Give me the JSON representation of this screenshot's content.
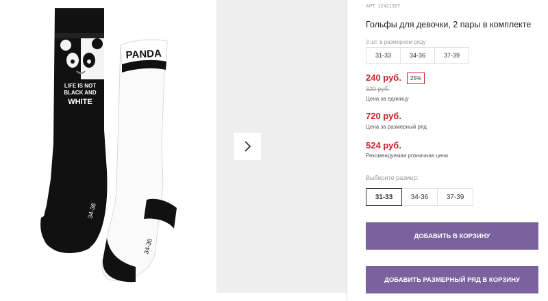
{
  "gallery": {
    "sock_left_print": [
      "LIFE IS NOT",
      "BLACK AND",
      "WHITE"
    ],
    "sock_right_print": "PANDA",
    "sock_size_mark": "34-36"
  },
  "product": {
    "article": "АРТ. 12421387",
    "title": "Гольфы для девочки, 2 пары в комплекте",
    "sizes_hint": "3 шт. в размерном ряду",
    "row_sizes": [
      "31-33",
      "34-36",
      "37-39"
    ],
    "price": "240 руб.",
    "discount": "25%",
    "old_price": "320 руб.",
    "price_unit_note": "Цена за единицу",
    "row_price": "720 руб.",
    "row_price_note": "Цена за размерный ряд",
    "rrp": "524 руб.",
    "rrp_note": "Рекомендуемая розничная цена",
    "choose_size_label": "Выберите размер:",
    "size_options": [
      "31-33",
      "34-36",
      "37-39"
    ],
    "selected_size": "31-33",
    "add_to_cart": "ДОБАВИТЬ В КОРЗИНУ",
    "add_row_to_cart": "ДОБАВИТЬ РАЗМЕРНЫЙ РЯД В КОРЗИНУ"
  },
  "colors": {
    "price_red": "#d0212c",
    "button_purple": "#7b619e"
  },
  "icons": {
    "next": "chevron-right-icon"
  }
}
